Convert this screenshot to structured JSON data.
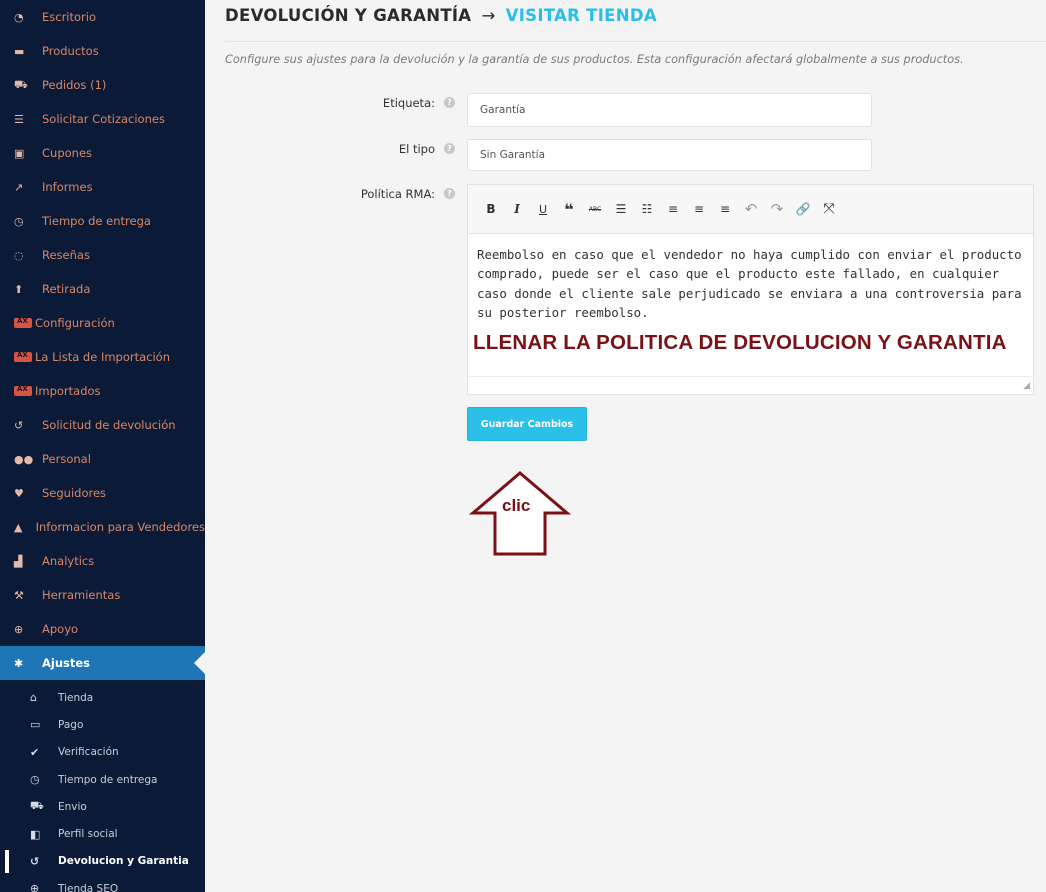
{
  "sidebar": {
    "items": [
      {
        "icon": "dashboard-icon",
        "label": "Escritorio"
      },
      {
        "icon": "briefcase-icon",
        "label": "Productos"
      },
      {
        "icon": "cart-icon",
        "label": "Pedidos (1)"
      },
      {
        "icon": "list-icon",
        "label": "Solicitar Cotizaciones"
      },
      {
        "icon": "gift-icon",
        "label": "Cupones"
      },
      {
        "icon": "chart-icon",
        "label": "Informes"
      },
      {
        "icon": "clock-icon",
        "label": "Tiempo de entrega"
      },
      {
        "icon": "comments-icon",
        "label": "Reseñas"
      },
      {
        "icon": "upload-icon",
        "label": "Retirada"
      },
      {
        "icon": "aliexpress-logo-icon",
        "label": "Configuración"
      },
      {
        "icon": "aliexpress-logo-icon",
        "label": "La Lista de Importación"
      },
      {
        "icon": "aliexpress-logo-icon",
        "label": "Importados"
      },
      {
        "icon": "undo-icon",
        "label": "Solicitud de devolución"
      },
      {
        "icon": "users-icon",
        "label": "Personal"
      },
      {
        "icon": "heart-icon",
        "label": "Seguidores"
      },
      {
        "icon": "bell-icon",
        "label": "Informacion para Vendedores"
      },
      {
        "icon": "area-chart-icon",
        "label": "Analytics"
      },
      {
        "icon": "wrench-icon",
        "label": "Herramientas"
      },
      {
        "icon": "life-ring-icon",
        "label": "Apoyo"
      },
      {
        "icon": "gear-icon",
        "label": "Ajustes"
      }
    ],
    "sub_items": [
      {
        "icon": "bank-icon",
        "label": "Tienda"
      },
      {
        "icon": "credit-card-icon",
        "label": "Pago"
      },
      {
        "icon": "check-icon",
        "label": "Verificación"
      },
      {
        "icon": "clock-icon",
        "label": "Tiempo de entrega"
      },
      {
        "icon": "truck-icon",
        "label": "Envio"
      },
      {
        "icon": "share-icon",
        "label": "Perfil social"
      },
      {
        "icon": "undo-icon",
        "label": "Devolucion y Garantia"
      },
      {
        "icon": "globe-icon",
        "label": "Tienda SEO"
      }
    ]
  },
  "header": {
    "title": "DEVOLUCIÓN Y GARANTÍA",
    "arrow": "→",
    "link": "VISITAR TIENDA"
  },
  "description": "Configure sus ajustes para la devolución y la garantía de sus productos. Esta configuración afectará globalmente a sus productos.",
  "form": {
    "label_field": {
      "label": "Etiqueta:",
      "value": "Garantía"
    },
    "type_field": {
      "label": "El tipo",
      "value": "Sin Garantía"
    },
    "policy_field": {
      "label": "Política RMA:",
      "text": "Reembolso en caso que el vendedor no haya cumplido con enviar el producto comprado, puede ser el caso que el producto  este fallado, en cualquier caso donde el cliente sale perjudicado se enviara a una controversia para su posterior reembolso."
    },
    "help_glyph": "?",
    "save_label": "Guardar Cambios"
  },
  "toolbar": [
    {
      "icon": "bold-icon",
      "glyph": "B"
    },
    {
      "icon": "italic-icon",
      "glyph": "I"
    },
    {
      "icon": "underline-icon",
      "glyph": "U"
    },
    {
      "icon": "blockquote-icon",
      "glyph": "❝"
    },
    {
      "icon": "strikethrough-icon",
      "glyph": "ABC"
    },
    {
      "icon": "bullet-list-icon",
      "glyph": "☰"
    },
    {
      "icon": "numbered-list-icon",
      "glyph": "☷"
    },
    {
      "icon": "align-left-icon",
      "glyph": "≡"
    },
    {
      "icon": "align-center-icon",
      "glyph": "≡"
    },
    {
      "icon": "align-right-icon",
      "glyph": "≡"
    },
    {
      "icon": "undo-icon",
      "glyph": "↶"
    },
    {
      "icon": "redo-icon",
      "glyph": "↷"
    },
    {
      "icon": "link-icon",
      "glyph": "🔗"
    },
    {
      "icon": "fullscreen-icon",
      "glyph": "⤧"
    }
  ],
  "annotations": {
    "note": "LLENAR LA POLITICA DE DEVOLUCION Y GARANTIA",
    "arrow_text": "clic"
  },
  "colors": {
    "sidebar_bg": "#0b1a36",
    "sidebar_text": "#d9876a",
    "active_bg": "#1f76b6",
    "accent": "#27bfe6",
    "annotation": "#7b1017"
  }
}
